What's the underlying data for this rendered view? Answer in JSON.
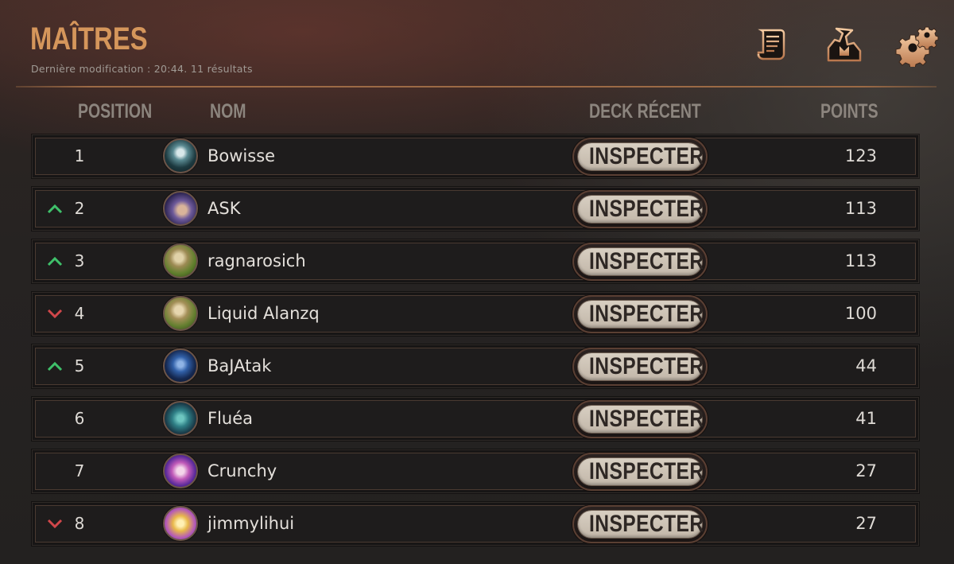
{
  "header": {
    "title": "MAÎTRES",
    "subtitle": "Dernière modification : 20:44. 11 résultats",
    "icons": [
      "scroll-icon",
      "champion-bust-icon",
      "gear-icon"
    ]
  },
  "columns": {
    "position": "POSITION",
    "name": "NOM",
    "deck": "DECK RÉCENT",
    "points": "POINTS"
  },
  "colors": {
    "accent": "#d5965b",
    "trend_up": "#3fc06a",
    "trend_down": "#d0474a",
    "button_face": "#d4cabd"
  },
  "rows": [
    {
      "position": "1",
      "trend": "none",
      "name": "Bowisse",
      "button": "INSPECTER",
      "points": "123",
      "avatar": "avatar-teal-skull"
    },
    {
      "position": "2",
      "trend": "up",
      "name": "ASK",
      "button": "INSPECTER",
      "points": "113",
      "avatar": "avatar-purple-figure"
    },
    {
      "position": "3",
      "trend": "up",
      "name": "ragnarosich",
      "button": "INSPECTER",
      "points": "113",
      "avatar": "avatar-gold-green"
    },
    {
      "position": "4",
      "trend": "down",
      "name": "Liquid Alanzq",
      "button": "INSPECTER",
      "points": "100",
      "avatar": "avatar-gold-green"
    },
    {
      "position": "5",
      "trend": "up",
      "name": "BaJAtak",
      "button": "INSPECTER",
      "points": "44",
      "avatar": "avatar-blue-armor"
    },
    {
      "position": "6",
      "trend": "none",
      "name": "Fluéa",
      "button": "INSPECTER",
      "points": "41",
      "avatar": "avatar-teal-creature"
    },
    {
      "position": "7",
      "trend": "none",
      "name": "Crunchy",
      "button": "INSPECTER",
      "points": "27",
      "avatar": "avatar-pink-poro"
    },
    {
      "position": "8",
      "trend": "down",
      "name": "jimmylihui",
      "button": "INSPECTER",
      "points": "27",
      "avatar": "avatar-golden-flower"
    }
  ]
}
